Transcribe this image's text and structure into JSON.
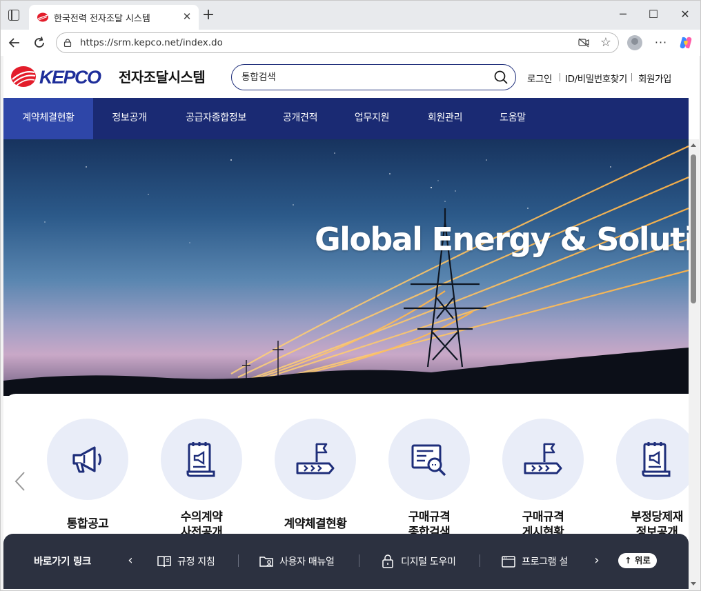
{
  "browser": {
    "tab_title": "한국전력 전자조달 시스템",
    "url": "https://srm.kepco.net/index.do",
    "window_controls": {
      "minimize": "─",
      "maximize": "☐",
      "close": "✕"
    }
  },
  "site": {
    "logo_text": "KEPCO",
    "title": "전자조달시스템",
    "search_placeholder": "통합검색",
    "utility_links": [
      "로그인",
      "ID/비밀번호찾기",
      "회원가입"
    ]
  },
  "gnb": {
    "items": [
      "계약체결현황",
      "정보공개",
      "공급자종합정보",
      "공개견적",
      "업무지원",
      "회원관리",
      "도움말"
    ],
    "active_index": 0
  },
  "hero": {
    "title": "Global Energy & Solution"
  },
  "services": [
    {
      "label": "통합공고",
      "icon": "megaphone-icon"
    },
    {
      "label": "수의계약 사전공개",
      "icon": "scroll-megaphone-icon"
    },
    {
      "label": "계약체결현황",
      "icon": "flag-arrow-icon"
    },
    {
      "label": "구매규격 종합검색",
      "icon": "document-search-icon"
    },
    {
      "label": "구매규격 게시현황",
      "icon": "flag-arrow-icon"
    },
    {
      "label": "부정당제재 정보공개",
      "icon": "scroll-megaphone-icon"
    }
  ],
  "quicklinks": {
    "title": "바로가기 링크",
    "items": [
      {
        "label": "규정 지침",
        "icon": "book-icon"
      },
      {
        "label": "사용자 매뉴얼",
        "icon": "folder-user-icon"
      },
      {
        "label": "디지털 도우미",
        "icon": "lock-icon"
      },
      {
        "label": "프로그램 설",
        "icon": "window-icon"
      }
    ],
    "to_top": "↑ 위로"
  },
  "colors": {
    "brand_navy": "#1a2a73",
    "gnb_active": "#2e46a8",
    "kepco_red": "#e31d2b",
    "card_circle": "#e9edf8",
    "icon_navy": "#1e2e7a",
    "quicklink_bg": "#2c3140"
  }
}
